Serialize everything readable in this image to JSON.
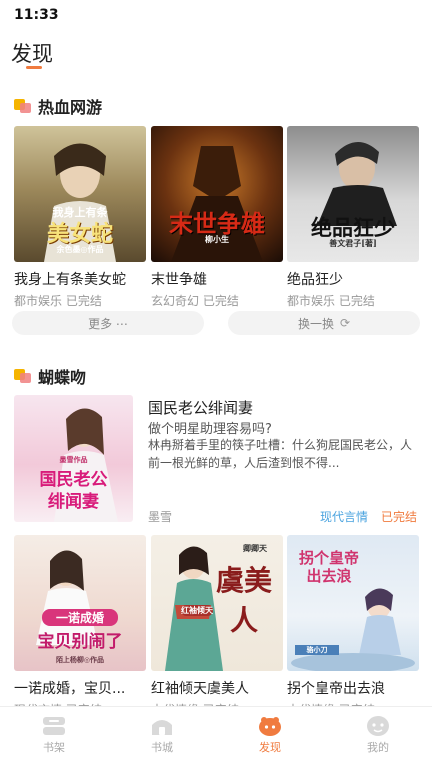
{
  "status": {
    "time": "11:33"
  },
  "page": {
    "title": "发现"
  },
  "section1": {
    "title": "热血网游",
    "books": [
      {
        "name": "我身上有条美女蛇",
        "meta": "都市娱乐 已完结",
        "cover_line1": "我身上有条",
        "cover_line2": "美女蛇",
        "cover_author": "余色墨◎作品"
      },
      {
        "name": "末世争雄",
        "meta": "玄幻奇幻 已完结",
        "cover_line1": "末世争雄",
        "cover_author": "柳小生"
      },
      {
        "name": "绝品狂少",
        "meta": "都市娱乐 已完结",
        "cover_line1": "绝品狂少",
        "cover_author": "善文君子[著]"
      }
    ],
    "more_label": "更多 ⋯",
    "refresh_label": "换一换"
  },
  "section2": {
    "title": "蝴蝶吻",
    "feature": {
      "title": "国民老公绯闻妻",
      "desc1": "做个明星助理容易吗?",
      "desc2": "林冉掰着手里的筷子吐槽：什么狗屁国民老公，人前一根光鲜的草，人后渣到恨不得...",
      "author": "墨雪",
      "tag": "现代言情",
      "status": "已完结",
      "cover_top": "墨雪作品",
      "cover_line1": "国民老公",
      "cover_line2": "绯闻妻"
    },
    "books": [
      {
        "name": "一诺成婚，宝贝...",
        "meta": "现代言情 已完结",
        "cover_line1": "一诺成婚",
        "cover_line2": "宝贝别闹了",
        "cover_author": "陌上杨柳◎作品"
      },
      {
        "name": "红袖倾天虞美人",
        "meta": "古代情缘 已完结",
        "cover_line1": "虞美人",
        "cover_line2": "红袖倾天",
        "cover_author": "卿卿天"
      },
      {
        "name": "拐个皇帝出去浪",
        "meta": "古代情缘 已完结",
        "cover_line1": "拐个皇帝出去浪",
        "cover_author": "骆小刀"
      }
    ]
  },
  "tabbar": {
    "items": [
      {
        "label": "书架",
        "icon": "bookshelf-icon"
      },
      {
        "label": "书城",
        "icon": "bookstore-icon"
      },
      {
        "label": "发现",
        "icon": "discover-icon",
        "active": true
      },
      {
        "label": "我的",
        "icon": "profile-icon"
      }
    ]
  },
  "colors": {
    "accent": "#f07b3f",
    "tag_blue": "#4aa3df",
    "muted": "#999999"
  }
}
